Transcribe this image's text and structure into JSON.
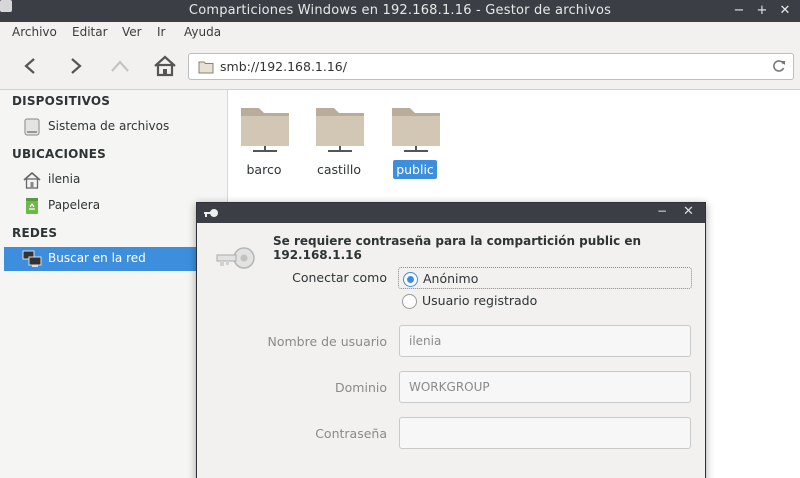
{
  "window": {
    "title": "Comparticiones Windows en 192.168.1.16 - Gestor de archivos",
    "controls": {
      "minimize": "−",
      "maximize": "+",
      "close": "✕"
    }
  },
  "menu": [
    "Archivo",
    "Editar",
    "Ver",
    "Ir",
    "Ayuda"
  ],
  "toolbar": {
    "address": "smb://192.168.1.16/"
  },
  "sidebar": {
    "sections": [
      {
        "heading": "DISPOSITIVOS",
        "items": [
          {
            "label": "Sistema de archivos",
            "icon": "drive-icon"
          }
        ]
      },
      {
        "heading": "UBICACIONES",
        "items": [
          {
            "label": "ilenia",
            "icon": "home-icon"
          },
          {
            "label": "Papelera",
            "icon": "trash-icon"
          }
        ]
      },
      {
        "heading": "REDES",
        "items": [
          {
            "label": "Buscar en la red",
            "icon": "network-icon",
            "active": true
          }
        ]
      }
    ]
  },
  "files": [
    {
      "name": "barco",
      "selected": false
    },
    {
      "name": "castillo",
      "selected": false
    },
    {
      "name": "public",
      "selected": true
    }
  ],
  "dialog": {
    "message": "Se requiere contraseña para la compartición public en 192.168.1.16",
    "connect_as_label": "Conectar como",
    "options": [
      {
        "label": "Anónimo",
        "selected": true
      },
      {
        "label": "Usuario registrado",
        "selected": false
      }
    ],
    "username_label": "Nombre de usuario",
    "username_value": "ilenia",
    "domain_label": "Dominio",
    "domain_value": "WORKGROUP",
    "password_label": "Contraseña",
    "password_value": "",
    "controls": {
      "minimize": "−",
      "close": "✕"
    }
  },
  "colors": {
    "accent": "#3d8fde",
    "titlebar": "#3b3f45",
    "folder": "#d2c6b5"
  }
}
